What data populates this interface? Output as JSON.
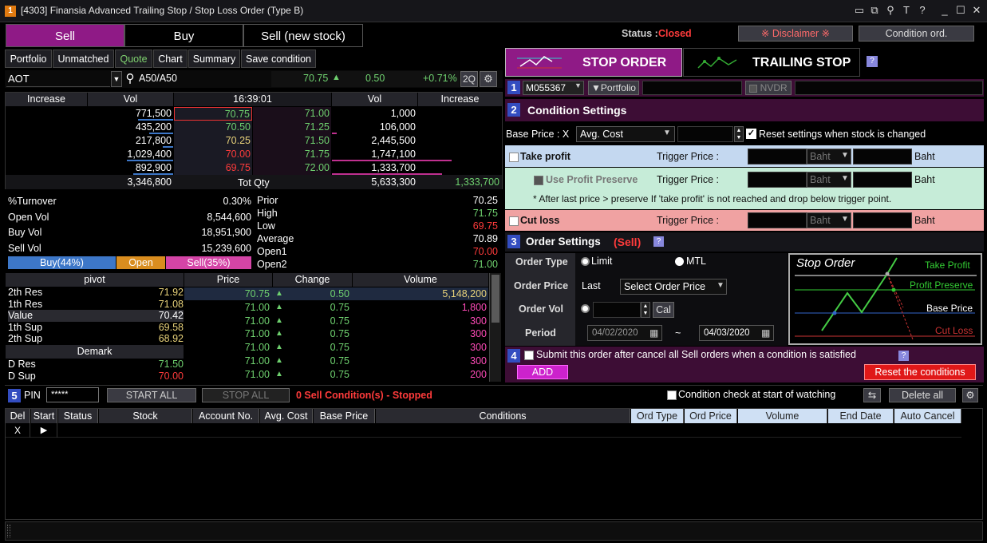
{
  "window": {
    "icon": "1",
    "title": "[4303] Finansia Advanced Trailing Stop / Stop Loss Order (Type B)"
  },
  "tabs": {
    "sell": "Sell",
    "buy": "Buy",
    "sell_new": "Sell (new stock)"
  },
  "subtabs": [
    "Portfolio",
    "Unmatched",
    "Quote",
    "Chart",
    "Summary",
    "Save condition"
  ],
  "symbol": {
    "name": "AOT",
    "board": "A50/A50",
    "last": "70.75",
    "change": "0.50",
    "pct": "+0.71%",
    "twoq": "2Q"
  },
  "book": {
    "hdr": {
      "inc": "Increase",
      "vol": "Vol",
      "time": "16:39:01",
      "vol2": "Vol",
      "inc2": "Increase"
    },
    "bid_vol": [
      "771,500",
      "435,200",
      "217,800",
      "1,029,400",
      "892,900"
    ],
    "bid_px": [
      "70.75",
      "70.50",
      "70.25",
      "70.00",
      "69.75"
    ],
    "ask_px": [
      "71.00",
      "71.25",
      "71.50",
      "71.75",
      "72.00"
    ],
    "ask_vol": [
      "1,000",
      "106,000",
      "2,445,500",
      "1,747,100",
      "1,333,700"
    ],
    "tot_bid": "3,346,800",
    "tot_label": "Tot Qty",
    "tot_ask": "5,633,300",
    "tot_inc": "1,333,700"
  },
  "stats_left": [
    {
      "k": "%Turnover",
      "v": "0.30%"
    },
    {
      "k": "Open Vol",
      "v": "8,544,600"
    },
    {
      "k": "Buy Vol",
      "v": "18,951,900"
    },
    {
      "k": "Sell Vol",
      "v": "15,239,600"
    }
  ],
  "stats_right": [
    {
      "k": "Prior",
      "v": "70.25"
    },
    {
      "k": "High",
      "v": "71.75"
    },
    {
      "k": "Low",
      "v": "69.75"
    },
    {
      "k": "Average",
      "v": "70.89"
    },
    {
      "k": "Open1",
      "v": "70.00"
    },
    {
      "k": "Open2",
      "v": "71.00"
    }
  ],
  "bars": {
    "buy": "Buy(44%)",
    "open": "Open",
    "sell": "Sell(35%)"
  },
  "pivot": {
    "title": "pivot",
    "rows": [
      {
        "k": "2th Res",
        "v": "71.92"
      },
      {
        "k": "1th Res",
        "v": "71.08"
      },
      {
        "k": "Value",
        "v": "70.42"
      },
      {
        "k": "1th Sup",
        "v": "69.58"
      },
      {
        "k": "2th Sup",
        "v": "68.92"
      }
    ],
    "demark": "Demark",
    "drows": [
      {
        "k": "D Res",
        "v": "71.50"
      },
      {
        "k": "D Sup",
        "v": "70.00"
      }
    ]
  },
  "ticks": {
    "hdr": [
      "Price",
      "Change",
      "Volume"
    ],
    "rows": [
      [
        "70.75",
        "0.50",
        "5,148,200"
      ],
      [
        "71.00",
        "0.75",
        "1,800"
      ],
      [
        "71.00",
        "0.75",
        "300"
      ],
      [
        "71.00",
        "0.75",
        "300"
      ],
      [
        "71.00",
        "0.75",
        "300"
      ],
      [
        "71.00",
        "0.75",
        "300"
      ],
      [
        "71.00",
        "0.75",
        "200"
      ]
    ]
  },
  "status": {
    "label": "Status :",
    "value": "Closed"
  },
  "disclaimer": "※ Disclaimer ※",
  "cond_ord": "Condition ord.",
  "modes": {
    "stop": "STOP ORDER",
    "trailing": "TRAILING STOP",
    "help": "?"
  },
  "sec1": {
    "num": "1",
    "account": "M055367",
    "portfolio": "▼Portfolio",
    "nvdr": "NVDR"
  },
  "sec2": {
    "num": "2",
    "title": "Condition Settings",
    "base_label": "Base Price : X",
    "base_value": "Avg. Cost",
    "reset_label": "Reset settings when stock is changed"
  },
  "tp": {
    "label": "Take profit",
    "trig": "Trigger Price :",
    "unit": "Baht",
    "baht": "Baht"
  },
  "pp": {
    "label": "Use Profit Preserve",
    "trig": "Trigger Price :",
    "unit": "Baht",
    "baht": "Baht",
    "note": "* After last price > preserve If 'take profit' is not reached and drop below trigger point."
  },
  "cl": {
    "label": "Cut loss",
    "trig": "Trigger Price :",
    "unit": "Baht",
    "baht": "Baht"
  },
  "sec3": {
    "num": "3",
    "title": "Order Settings",
    "side": "(Sell)",
    "help": "?",
    "order_type": "Order Type",
    "limit": "Limit",
    "mtl": "MTL",
    "order_price": "Order Price",
    "last": "Last",
    "select_price": "Select Order Price",
    "order_vol": "Order Vol",
    "cal": "Cal",
    "period": "Period",
    "from": "04/02/2020",
    "tilde": "~",
    "to": "04/03/2020"
  },
  "diagram": {
    "title": "Stop Order",
    "tp": "Take Profit",
    "pp": "Profit Preserve",
    "bp": "Base Price",
    "cl": "Cut Loss"
  },
  "sec4": {
    "num": "4",
    "text": "Submit this order after cancel all Sell orders when a condition is satisfied",
    "help": "?",
    "add": "ADD",
    "reset": "Reset the conditions"
  },
  "sec5": {
    "num": "5",
    "pin": "PIN",
    "pin_val": "*****",
    "start_all": "START ALL",
    "stop_all": "STOP ALL",
    "cond_status": "0 Sell Condition(s) -  Stopped",
    "check_label": "Condition check at start of watching",
    "delete_all": "Delete all"
  },
  "table": {
    "hdr": [
      "Del",
      "Start",
      "Status",
      "Stock",
      "Account No.",
      "Avg. Cost",
      "Base Price",
      "Conditions",
      "Ord Type",
      "Ord Price",
      "Volume",
      "End Date",
      "Auto Cancel"
    ],
    "row": [
      "X",
      "▶"
    ]
  },
  "colors": {
    "purple": "#8f1a86",
    "accent_green": "#6fd16f",
    "red": "#ff3b3b",
    "magenta_sec": "#3d0d35"
  }
}
